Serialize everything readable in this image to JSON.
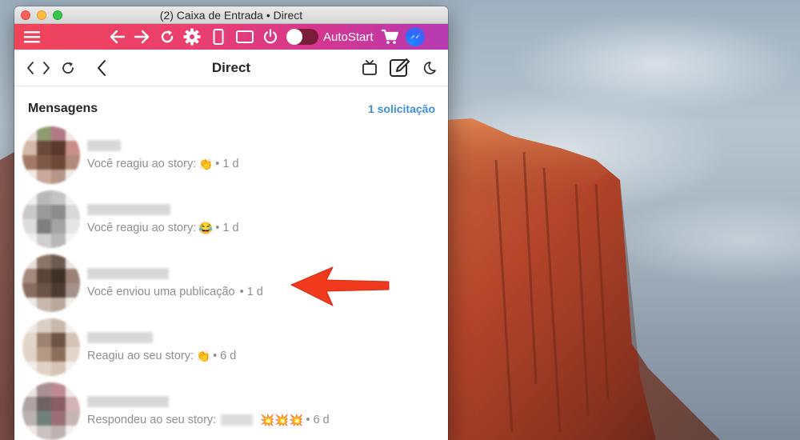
{
  "window": {
    "title": "(2) Caixa de Entrada • Direct"
  },
  "toolbar": {
    "autostart_label": "AutoStart",
    "autostart_on": false,
    "icons": [
      "menu-icon",
      "arrow-left-icon",
      "arrow-right-icon",
      "refresh-icon",
      "gear-icon",
      "phone-icon",
      "tablet-icon",
      "power-icon",
      "cart-icon",
      "messenger-icon"
    ]
  },
  "nav": {
    "title": "Direct",
    "icons": [
      "chevron-left-icon",
      "chevron-right-icon",
      "reload-icon",
      "back-icon",
      "tv-icon",
      "compose-icon",
      "moon-icon"
    ]
  },
  "section": {
    "title": "Mensagens",
    "requests_link": "1 solicitação"
  },
  "messages": [
    {
      "text": "Você reagiu ao story:",
      "emoji": "👏",
      "time": "• 1 d"
    },
    {
      "text": "Você reagiu ao story:",
      "emoji": "😂",
      "time": "• 1 d"
    },
    {
      "text": "Você enviou uma publicação",
      "emoji": "",
      "time": "• 1 d"
    },
    {
      "text": "Reagiu ao seu story:",
      "emoji": "👏",
      "time": "• 6 d"
    },
    {
      "text": "Respondeu ao seu story:",
      "emoji": "💥💥💥",
      "time": "• 6 d"
    }
  ],
  "colors": {
    "toolbar_start": "#f0445a",
    "toolbar_end": "#b53ab3",
    "link": "#3d8fd8",
    "annotation_arrow": "#f03a1e"
  }
}
